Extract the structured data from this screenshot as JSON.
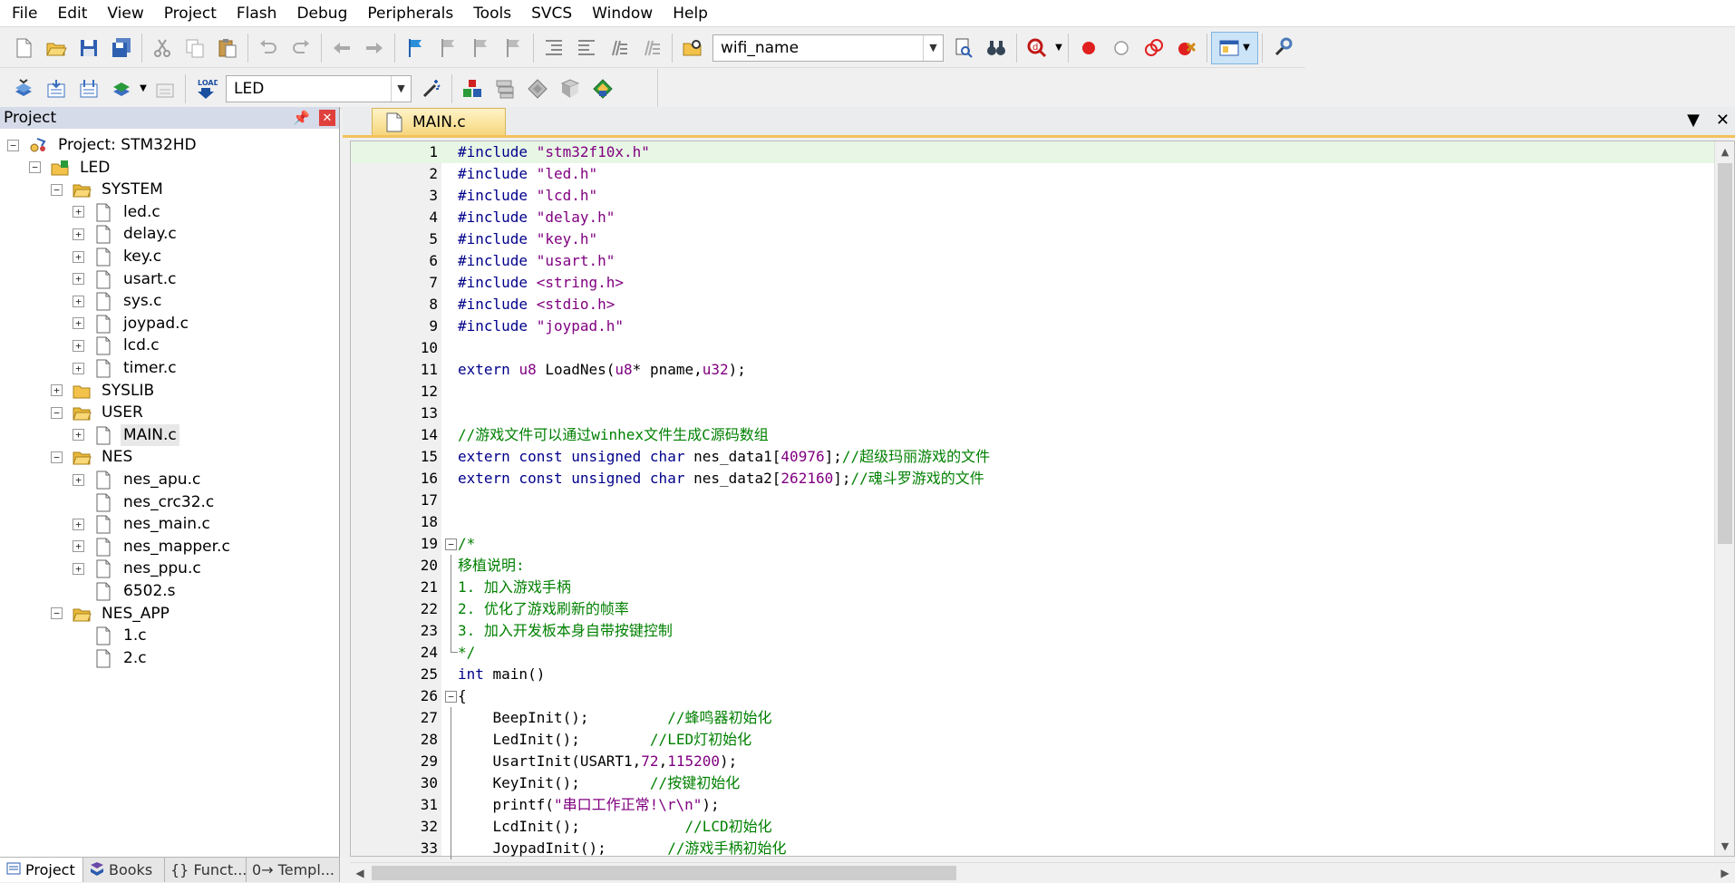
{
  "menubar": {
    "items": [
      "File",
      "Edit",
      "View",
      "Project",
      "Flash",
      "Debug",
      "Peripherals",
      "Tools",
      "SVCS",
      "Window",
      "Help"
    ]
  },
  "toolbar1": {
    "target_combo": "wifi_name"
  },
  "toolbar2": {
    "target_combo": "LED"
  },
  "project_panel": {
    "title": "Project",
    "pin_icon": "pin-icon",
    "tree": [
      {
        "label": "Project: STM32HD",
        "level": 0,
        "type": "project",
        "exp": "-"
      },
      {
        "label": "LED",
        "level": 1,
        "type": "target",
        "exp": "-"
      },
      {
        "label": "SYSTEM",
        "level": 2,
        "type": "folder-open",
        "exp": "-"
      },
      {
        "label": "led.c",
        "level": 3,
        "type": "file",
        "exp": "+"
      },
      {
        "label": "delay.c",
        "level": 3,
        "type": "file",
        "exp": "+"
      },
      {
        "label": "key.c",
        "level": 3,
        "type": "file",
        "exp": "+"
      },
      {
        "label": "usart.c",
        "level": 3,
        "type": "file",
        "exp": "+"
      },
      {
        "label": "sys.c",
        "level": 3,
        "type": "file",
        "exp": "+"
      },
      {
        "label": "joypad.c",
        "level": 3,
        "type": "file",
        "exp": "+"
      },
      {
        "label": "lcd.c",
        "level": 3,
        "type": "file",
        "exp": "+"
      },
      {
        "label": "timer.c",
        "level": 3,
        "type": "file",
        "exp": "+"
      },
      {
        "label": "SYSLIB",
        "level": 2,
        "type": "folder",
        "exp": "+"
      },
      {
        "label": "USER",
        "level": 2,
        "type": "folder-open",
        "exp": "-"
      },
      {
        "label": "MAIN.c",
        "level": 3,
        "type": "file",
        "exp": "+",
        "selected": true
      },
      {
        "label": "NES",
        "level": 2,
        "type": "folder-open",
        "exp": "-"
      },
      {
        "label": "nes_apu.c",
        "level": 3,
        "type": "file",
        "exp": "+"
      },
      {
        "label": "nes_crc32.c",
        "level": 3,
        "type": "file",
        "exp": ""
      },
      {
        "label": "nes_main.c",
        "level": 3,
        "type": "file",
        "exp": "+"
      },
      {
        "label": "nes_mapper.c",
        "level": 3,
        "type": "file",
        "exp": "+"
      },
      {
        "label": "nes_ppu.c",
        "level": 3,
        "type": "file",
        "exp": "+"
      },
      {
        "label": "6502.s",
        "level": 3,
        "type": "file",
        "exp": ""
      },
      {
        "label": "NES_APP",
        "level": 2,
        "type": "folder-open",
        "exp": "-"
      },
      {
        "label": "1.c",
        "level": 3,
        "type": "file",
        "exp": ""
      },
      {
        "label": "2.c",
        "level": 3,
        "type": "file",
        "exp": ""
      }
    ],
    "tabs": [
      "Project",
      "Books",
      "{} Funct...",
      "0→ Templ..."
    ]
  },
  "editor": {
    "tab_label": "MAIN.c",
    "lines": [
      {
        "n": "1",
        "tokens": [
          [
            "pp",
            "#include "
          ],
          [
            "str",
            "\"stm32f10x.h\""
          ]
        ],
        "current": true
      },
      {
        "n": "2",
        "tokens": [
          [
            "pp",
            "#include "
          ],
          [
            "str",
            "\"led.h\""
          ]
        ]
      },
      {
        "n": "3",
        "tokens": [
          [
            "pp",
            "#include "
          ],
          [
            "str",
            "\"lcd.h\""
          ]
        ]
      },
      {
        "n": "4",
        "tokens": [
          [
            "pp",
            "#include "
          ],
          [
            "str",
            "\"delay.h\""
          ]
        ]
      },
      {
        "n": "5",
        "tokens": [
          [
            "pp",
            "#include "
          ],
          [
            "str",
            "\"key.h\""
          ]
        ]
      },
      {
        "n": "6",
        "tokens": [
          [
            "pp",
            "#include "
          ],
          [
            "str",
            "\"usart.h\""
          ]
        ]
      },
      {
        "n": "7",
        "tokens": [
          [
            "pp",
            "#include "
          ],
          [
            "str",
            "<string.h>"
          ]
        ]
      },
      {
        "n": "8",
        "tokens": [
          [
            "pp",
            "#include "
          ],
          [
            "str",
            "<stdio.h>"
          ]
        ]
      },
      {
        "n": "9",
        "tokens": [
          [
            "pp",
            "#include "
          ],
          [
            "str",
            "\"joypad.h\""
          ]
        ]
      },
      {
        "n": "10",
        "tokens": []
      },
      {
        "n": "11",
        "tokens": [
          [
            "kw",
            "extern "
          ],
          [
            "num",
            "u8"
          ],
          [
            "id",
            " LoadNes("
          ],
          [
            "num",
            "u8"
          ],
          [
            "id",
            "* pname,"
          ],
          [
            "num",
            "u32"
          ],
          [
            "id",
            ");"
          ]
        ]
      },
      {
        "n": "12",
        "tokens": []
      },
      {
        "n": "13",
        "tokens": []
      },
      {
        "n": "14",
        "tokens": [
          [
            "cm",
            "//游戏文件可以通过winhex文件生成C源码数组"
          ]
        ]
      },
      {
        "n": "15",
        "tokens": [
          [
            "kw",
            "extern const unsigned char "
          ],
          [
            "id",
            "nes_data1["
          ],
          [
            "num",
            "40976"
          ],
          [
            "id",
            "];"
          ],
          [
            "cm",
            "//超级玛丽游戏的文件"
          ]
        ]
      },
      {
        "n": "16",
        "tokens": [
          [
            "kw",
            "extern const unsigned char "
          ],
          [
            "id",
            "nes_data2["
          ],
          [
            "num",
            "262160"
          ],
          [
            "id",
            "];"
          ],
          [
            "cm",
            "//魂斗罗游戏的文件"
          ]
        ]
      },
      {
        "n": "17",
        "tokens": []
      },
      {
        "n": "18",
        "tokens": []
      },
      {
        "n": "19",
        "tokens": [
          [
            "cm",
            "/*"
          ]
        ],
        "fold": "start"
      },
      {
        "n": "20",
        "tokens": [
          [
            "cm",
            "移植说明:"
          ]
        ],
        "fold": "mid"
      },
      {
        "n": "21",
        "tokens": [
          [
            "cm",
            "1. 加入游戏手柄"
          ]
        ],
        "fold": "mid"
      },
      {
        "n": "22",
        "tokens": [
          [
            "cm",
            "2. 优化了游戏刷新的帧率"
          ]
        ],
        "fold": "mid"
      },
      {
        "n": "23",
        "tokens": [
          [
            "cm",
            "3. 加入开发板本身自带按键控制"
          ]
        ],
        "fold": "mid"
      },
      {
        "n": "24",
        "tokens": [
          [
            "cm",
            "*/"
          ]
        ],
        "fold": "end"
      },
      {
        "n": "25",
        "tokens": [
          [
            "kw",
            "int "
          ],
          [
            "id",
            "main()"
          ]
        ]
      },
      {
        "n": "26",
        "tokens": [
          [
            "id",
            "{"
          ]
        ],
        "fold": "start"
      },
      {
        "n": "27",
        "tokens": [
          [
            "id",
            "    BeepInit();         "
          ],
          [
            "cm",
            "//蜂鸣器初始化"
          ]
        ],
        "fold": "mid"
      },
      {
        "n": "28",
        "tokens": [
          [
            "id",
            "    LedInit();        "
          ],
          [
            "cm",
            "//LED灯初始化"
          ]
        ],
        "fold": "mid"
      },
      {
        "n": "29",
        "tokens": [
          [
            "id",
            "    UsartInit(USART1,"
          ],
          [
            "num",
            "72"
          ],
          [
            "id",
            ","
          ],
          [
            "num",
            "115200"
          ],
          [
            "id",
            ");"
          ]
        ],
        "fold": "mid"
      },
      {
        "n": "30",
        "tokens": [
          [
            "id",
            "    KeyInit();        "
          ],
          [
            "cm",
            "//按键初始化"
          ]
        ],
        "fold": "mid"
      },
      {
        "n": "31",
        "tokens": [
          [
            "id",
            "    printf("
          ],
          [
            "str",
            "\"串口工作正常!\\r\\n\""
          ],
          [
            "id",
            ");"
          ]
        ],
        "fold": "mid"
      },
      {
        "n": "32",
        "tokens": [
          [
            "id",
            "    LcdInit();            "
          ],
          [
            "cm",
            "//LCD初始化"
          ]
        ],
        "fold": "mid"
      },
      {
        "n": "33",
        "tokens": [
          [
            "id",
            "    JoypadInit();       "
          ],
          [
            "cm",
            "//游戏手柄初始化"
          ]
        ],
        "fold": "mid"
      }
    ]
  },
  "colors": {
    "keyword": "#00008b",
    "string": "#800080",
    "comment": "#008000",
    "tab_active": "#f6d77e",
    "current_line": "#e8f6e6"
  }
}
